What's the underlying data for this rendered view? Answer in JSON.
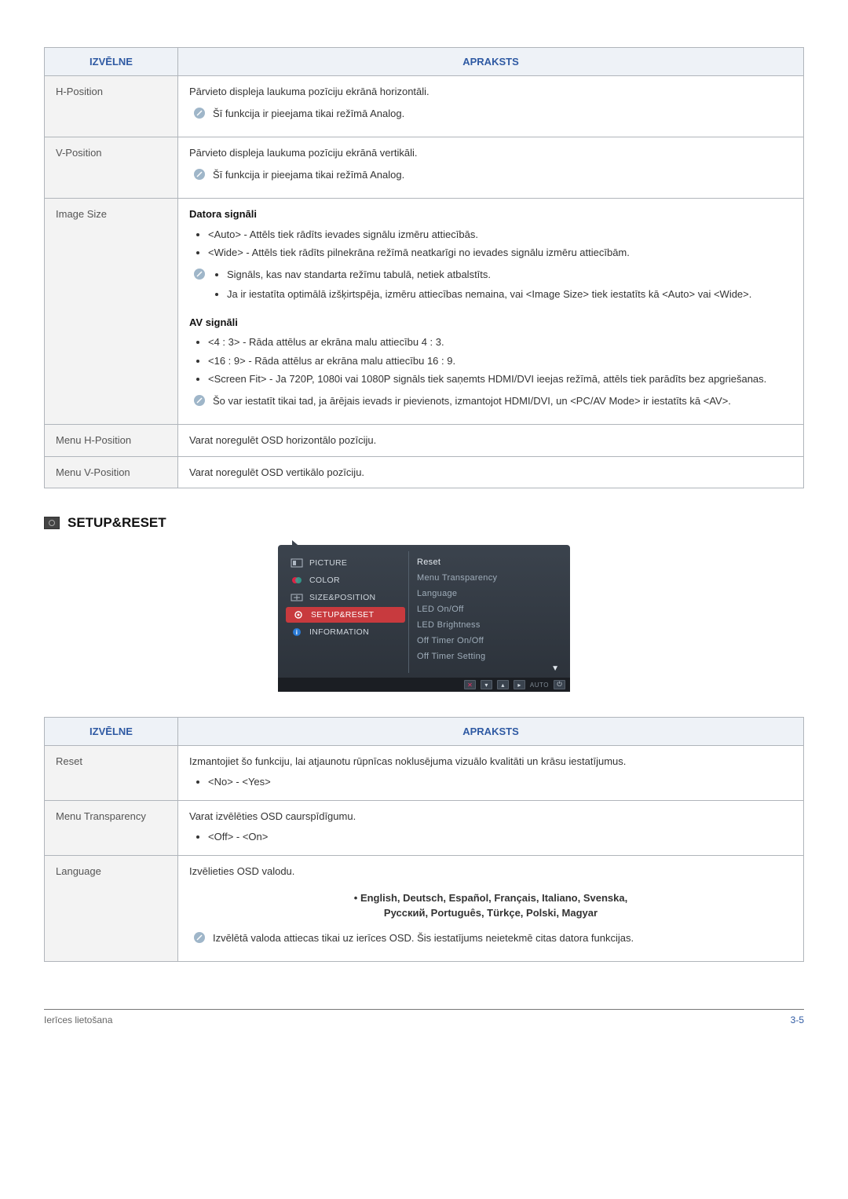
{
  "table1": {
    "headers": {
      "menu": "IZVĒLNE",
      "desc": "APRAKSTS"
    },
    "rows": [
      {
        "menu": "H-Position",
        "desc_main": "Pārvieto displeja laukuma pozīciju ekrānā horizontāli.",
        "note": "Šī funkcija ir pieejama tikai režīmā Analog."
      },
      {
        "menu": "V-Position",
        "desc_main": "Pārvieto displeja laukuma pozīciju ekrānā vertikāli.",
        "note": "Šī funkcija ir pieejama tikai režīmā Analog."
      },
      {
        "menu": "Image Size",
        "pc_heading": "Datora signāli",
        "pc_bullets": [
          "<Auto> - Attēls tiek rādīts ievades signālu izmēru attiecībās.",
          "<Wide> - Attēls tiek rādīts pilnekrāna režīmā neatkarīgi no ievades signālu izmēru attiecībām."
        ],
        "pc_note_bullets": [
          "Signāls, kas nav standarta režīmu tabulā, netiek atbalstīts.",
          "Ja ir iestatīta optimālā izšķirtspēja, izmēru attiecības nemaina, vai <Image Size> tiek iestatīts kā <Auto> vai <Wide>."
        ],
        "av_heading": "AV signāli",
        "av_bullets": [
          "<4 : 3> - Rāda attēlus ar ekrāna malu attiecību 4 : 3.",
          "<16 : 9> - Rāda attēlus ar ekrāna malu attiecību 16 : 9.",
          "<Screen Fit> - Ja 720P, 1080i vai 1080P signāls tiek saņemts HDMI/DVI ieejas režīmā, attēls tiek parādīts bez apgriešanas."
        ],
        "av_note": "Šo var iestatīt tikai tad, ja ārējais ievads ir pievienots, izmantojot HDMI/DVI, un <PC/AV Mode> ir iestatīts kā <AV>."
      },
      {
        "menu": "Menu H-Position",
        "desc_main": "Varat noregulēt OSD horizontālo pozīciju."
      },
      {
        "menu": "Menu V-Position",
        "desc_main": "Varat noregulēt OSD vertikālo pozīciju."
      }
    ]
  },
  "setup_title": "SETUP&RESET",
  "osd": {
    "left": [
      {
        "label": "PICTURE",
        "icon": "picture"
      },
      {
        "label": "COLOR",
        "icon": "color"
      },
      {
        "label": "SIZE&POSITION",
        "icon": "size"
      },
      {
        "label": "SETUP&RESET",
        "icon": "setup",
        "selected": true
      },
      {
        "label": "INFORMATION",
        "icon": "info"
      }
    ],
    "right": [
      {
        "label": "Reset",
        "strong": true
      },
      {
        "label": "Menu Transparency"
      },
      {
        "label": "Language"
      },
      {
        "label": "LED On/Off"
      },
      {
        "label": "LED Brightness"
      },
      {
        "label": "Off Timer On/Off"
      },
      {
        "label": "Off Timer Setting"
      }
    ],
    "footer_auto": "AUTO"
  },
  "table2": {
    "headers": {
      "menu": "IZVĒLNE",
      "desc": "APRAKSTS"
    },
    "rows": [
      {
        "menu": "Reset",
        "desc_main": "Izmantojiet šo funkciju, lai atjaunotu rūpnīcas noklusējuma vizuālo kvalitāti un krāsu iestatījumus.",
        "bullets": [
          "<No> - <Yes>"
        ]
      },
      {
        "menu": "Menu Transparency",
        "desc_main": "Varat izvēlēties OSD caurspīdīgumu.",
        "bullets": [
          "<Off> - <On>"
        ]
      },
      {
        "menu": "Language",
        "desc_main": "Izvēlieties OSD valodu.",
        "lang_line1": "English, Deutsch, Español, Français, Italiano, Svenska,",
        "lang_line2": "Русский, Português, Türkçe, Polski, Magyar",
        "note": "Izvēlētā valoda attiecas tikai uz ierīces OSD. Šis iestatījums neietekmē citas datora funkcijas."
      }
    ]
  },
  "footer": {
    "left": "Ierīces lietošana",
    "right": "3-5"
  }
}
